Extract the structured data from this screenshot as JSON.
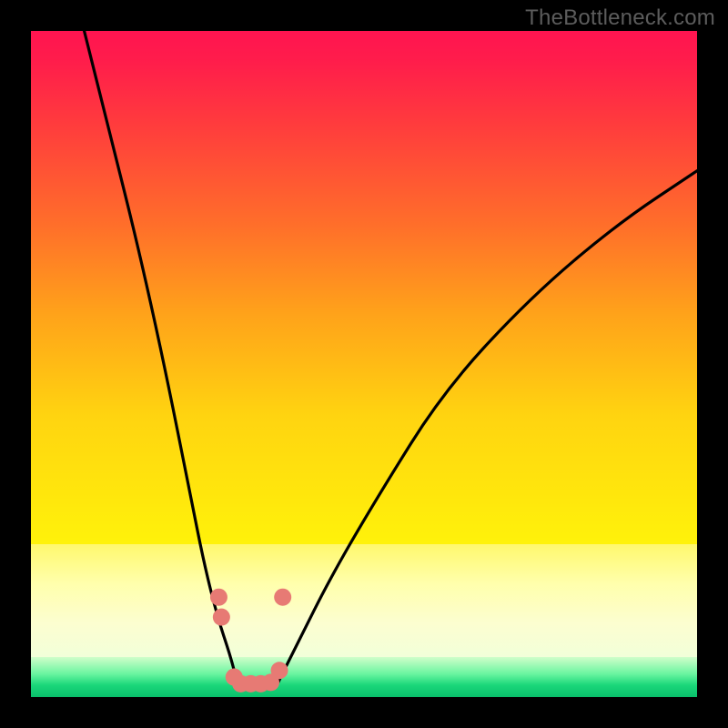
{
  "watermark": "TheBottleneck.com",
  "chart_data": {
    "type": "line",
    "title": "",
    "xlabel": "",
    "ylabel": "",
    "xlim": [
      0,
      100
    ],
    "ylim": [
      0,
      100
    ],
    "background_bands": [
      {
        "from_pct": 0,
        "to_pct": 77,
        "desc": "red-to-yellow gradient"
      },
      {
        "from_pct": 77,
        "to_pct": 94,
        "desc": "pale yellow band"
      },
      {
        "from_pct": 94,
        "to_pct": 100,
        "desc": "green band"
      }
    ],
    "series": [
      {
        "name": "left-branch",
        "x": [
          8,
          12,
          16,
          20,
          24,
          26,
          28,
          30,
          31
        ],
        "y": [
          100,
          84,
          68,
          50,
          30,
          20,
          12,
          6,
          2
        ]
      },
      {
        "name": "right-branch",
        "x": [
          37,
          40,
          45,
          52,
          62,
          75,
          88,
          100
        ],
        "y": [
          2,
          8,
          18,
          30,
          46,
          60,
          71,
          79
        ]
      },
      {
        "name": "valley-dots",
        "x": [
          28.2,
          28.6,
          30.5,
          31.5,
          33.0,
          34.5,
          36.0,
          37.3,
          37.8
        ],
        "y": [
          15,
          12,
          3,
          2,
          2,
          2,
          2.2,
          4,
          15
        ]
      }
    ],
    "valley_flat": {
      "x_from": 31,
      "x_to": 37,
      "y": 2
    }
  }
}
